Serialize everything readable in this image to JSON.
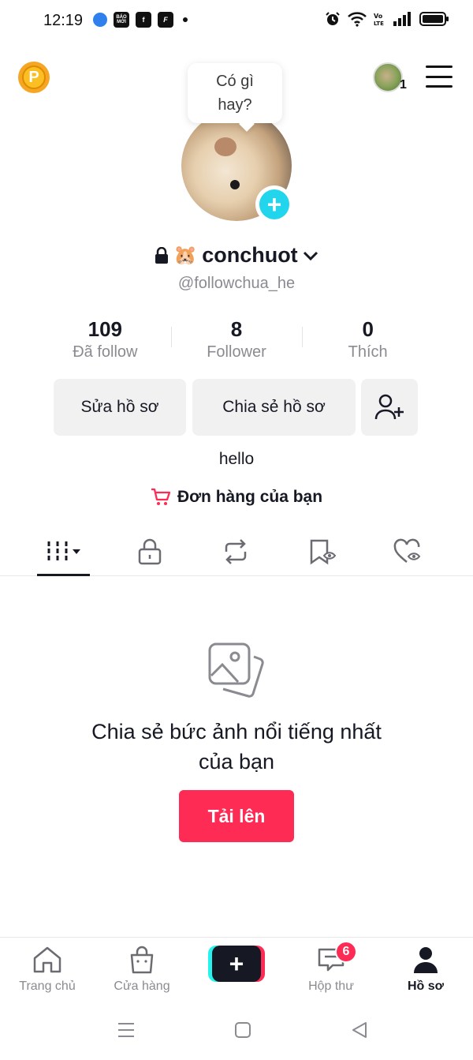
{
  "status_bar": {
    "time": "12:19",
    "left_icons": [
      "messenger-icon",
      "baomoi-icon",
      "facebook-icon",
      "flipboard-icon",
      "notification-dot-icon"
    ],
    "right_icons": [
      "alarm-icon",
      "wifi-icon",
      "volte-icon",
      "signal-icon",
      "battery-icon"
    ],
    "baomoi_label": "BÁO MỚI"
  },
  "top_bar": {
    "coin_label": "P",
    "account_count": "1"
  },
  "profile": {
    "bubble_text": "Có gì hay?",
    "display_name": "conchuot",
    "name_emoji": "🐹",
    "handle": "@followchua_he",
    "stats": [
      {
        "value": "109",
        "label": "Đã follow"
      },
      {
        "value": "8",
        "label": "Follower"
      },
      {
        "value": "0",
        "label": "Thích"
      }
    ],
    "edit_button": "Sửa hồ sơ",
    "share_button": "Chia sẻ hồ sơ",
    "bio": "hello",
    "orders_label": "Đơn hàng của bạn"
  },
  "tabs": [
    "videos-grid-icon",
    "private-lock-icon",
    "repost-icon",
    "favorites-icon",
    "liked-icon"
  ],
  "empty_state": {
    "title": "Chia sẻ bức ảnh nổi tiếng nhất của bạn",
    "button": "Tải lên"
  },
  "bottom_nav": {
    "items": [
      {
        "label": "Trang chủ",
        "icon": "home-icon"
      },
      {
        "label": "Cửa hàng",
        "icon": "shop-icon"
      },
      {
        "label": "",
        "icon": "create-icon"
      },
      {
        "label": "Hộp thư",
        "icon": "inbox-icon"
      },
      {
        "label": "Hồ sơ",
        "icon": "profile-icon"
      }
    ],
    "inbox_badge": "6",
    "active": "Hồ sơ"
  },
  "colors": {
    "accent": "#fe2c55",
    "cyan": "#20d5ec",
    "text": "#161823",
    "muted": "#8a8b91"
  }
}
